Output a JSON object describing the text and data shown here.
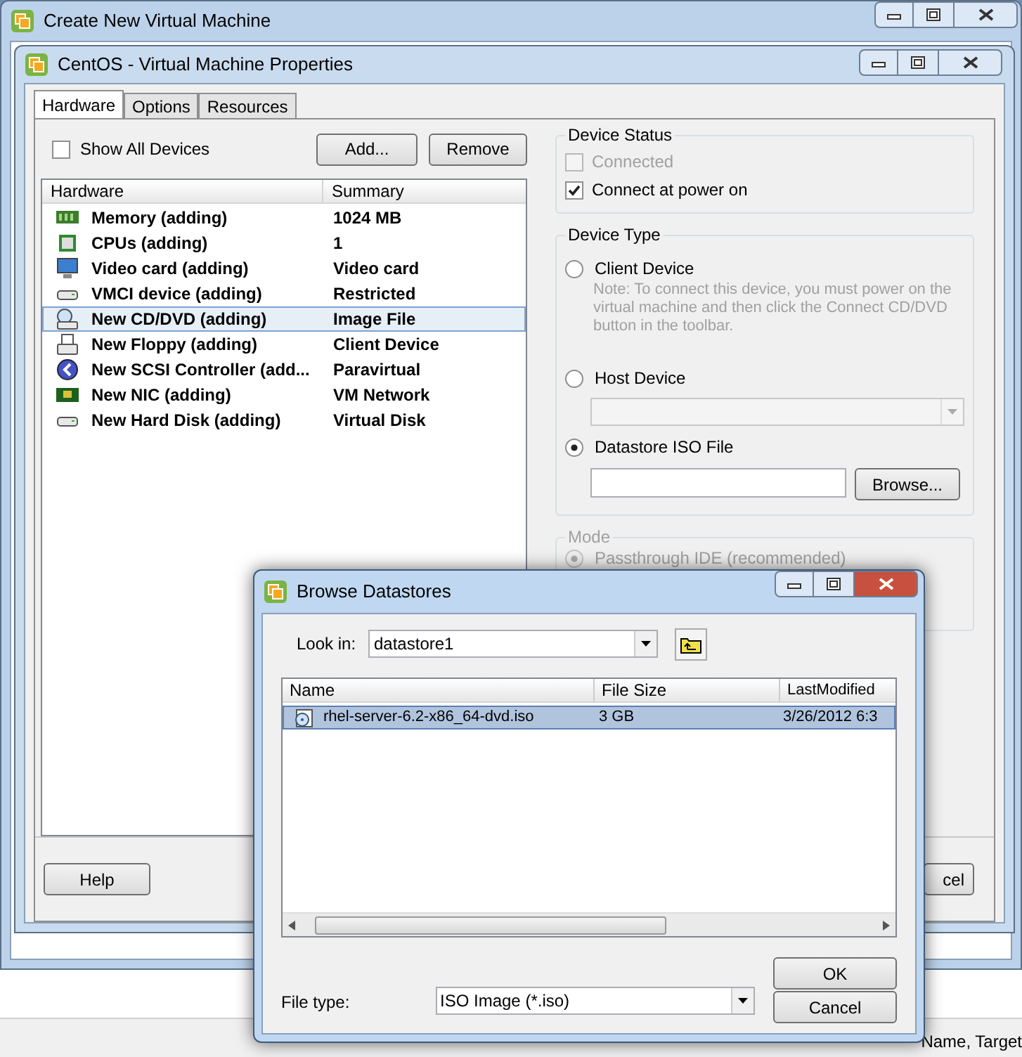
{
  "main_window": {
    "title": "Create New Virtual Machine",
    "status_text": "Name, Target"
  },
  "properties_window": {
    "title": "CentOS - Virtual Machine Properties",
    "tabs": [
      {
        "label": "Hardware",
        "selected": true
      },
      {
        "label": "Options",
        "selected": false
      },
      {
        "label": "Resources",
        "selected": false
      }
    ],
    "show_all_devices": {
      "label": "Show All Devices",
      "checked": false
    },
    "list_buttons": [
      "Add...",
      "Remove"
    ],
    "hardware_table": {
      "columns": [
        "Hardware",
        "Summary"
      ],
      "rows": [
        {
          "kind": "memory",
          "device": "Memory (adding)",
          "summary": "1024 MB",
          "selected": false
        },
        {
          "kind": "cpu",
          "device": "CPUs (adding)",
          "summary": "1",
          "selected": false
        },
        {
          "kind": "video",
          "device": "Video card  (adding)",
          "summary": "Video card",
          "selected": false
        },
        {
          "kind": "drive",
          "device": "VMCI device (adding)",
          "summary": "Restricted",
          "selected": false
        },
        {
          "kind": "cdrom",
          "device": "New CD/DVD (adding)",
          "summary": "Image File",
          "selected": true
        },
        {
          "kind": "floppy",
          "device": "New Floppy (adding)",
          "summary": "Client Device",
          "selected": false
        },
        {
          "kind": "scsi",
          "device": "New SCSI Controller (add...",
          "summary": "Paravirtual",
          "selected": false
        },
        {
          "kind": "nic",
          "device": "New NIC (adding)",
          "summary": "VM Network",
          "selected": false
        },
        {
          "kind": "drive",
          "device": "New Hard Disk (adding)",
          "summary": "Virtual Disk",
          "selected": false
        }
      ]
    },
    "device_status": {
      "title": "Device Status",
      "options": [
        {
          "label": "Connected",
          "checked": false,
          "disabled": true
        },
        {
          "label": "Connect at power on",
          "checked": true,
          "disabled": false
        }
      ]
    },
    "device_type": {
      "title": "Device Type",
      "options": [
        {
          "kind": "note",
          "label": "Client Device",
          "selected": false,
          "note": "Note: To connect this device, you must power on the virtual machine and then click the Connect CD/DVD button in the toolbar."
        },
        {
          "kind": "select",
          "label": "Host Device",
          "selected": false
        },
        {
          "kind": "file",
          "label": "Datastore ISO File",
          "selected": true,
          "button": "Browse..."
        }
      ]
    },
    "mode": {
      "title": "Mode",
      "options": [
        {
          "label": "Passthrough IDE (recommended)",
          "selected": true
        }
      ]
    },
    "footer_buttons": [
      "Help",
      "cel"
    ]
  },
  "browse_dialog": {
    "title": "Browse Datastores",
    "look_in_label": "Look in:",
    "look_in_value": "datastore1",
    "columns": [
      "Name",
      "File Size",
      "LastModified"
    ],
    "files": [
      {
        "name": "rhel-server-6.2-x86_64-dvd.iso",
        "size": "3 GB",
        "modified": "3/26/2012 6:3",
        "selected": true
      }
    ],
    "file_type_label": "File type:",
    "file_type_value": "ISO Image (*.iso)",
    "buttons": [
      "OK",
      "Cancel"
    ]
  }
}
